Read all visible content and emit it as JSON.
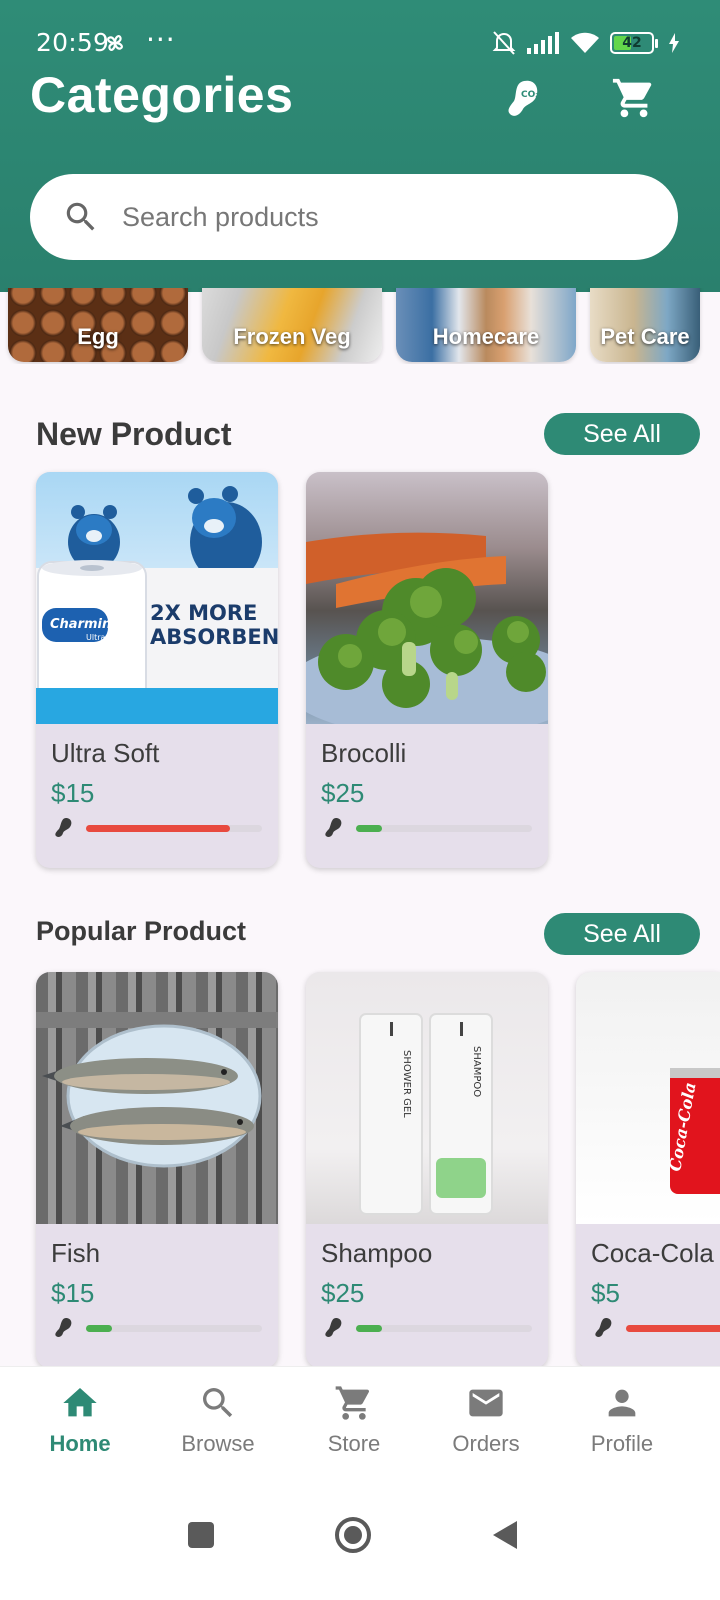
{
  "status_bar": {
    "time": "20:59",
    "dots": "···",
    "battery": "42"
  },
  "header": {
    "title": "Categories"
  },
  "search": {
    "placeholder": "Search products"
  },
  "categories": [
    {
      "label": "Egg"
    },
    {
      "label": "Frozen Veg"
    },
    {
      "label": "Homecare"
    },
    {
      "label": "Pet Care"
    }
  ],
  "new_product": {
    "title": "New Product",
    "see_all": "See All",
    "items": [
      {
        "name": "Ultra Soft",
        "price": "$15",
        "co2_level": 0.82,
        "co2_color": "#e84a3f"
      },
      {
        "name": "Brocolli",
        "price": "$25",
        "co2_level": 0.15,
        "co2_color": "#4caf50"
      }
    ]
  },
  "popular_product": {
    "title": "Popular Product",
    "see_all": "See All",
    "items": [
      {
        "name": "Fish",
        "price": "$15",
        "co2_level": 0.15,
        "co2_color": "#4caf50"
      },
      {
        "name": "Shampoo",
        "price": "$25",
        "co2_level": 0.15,
        "co2_color": "#4caf50"
      },
      {
        "name": "Coca-Cola",
        "price": "$5",
        "co2_level": 0.82,
        "co2_color": "#e84a3f"
      }
    ]
  },
  "image_text": {
    "charmin_logo": "Charmin",
    "charmin_sub": "Ultra Soft",
    "charmin_claim_1": "2X MORE",
    "charmin_claim_2": "ABSORBENT",
    "shower_gel": "SHOWER GEL",
    "shampoo": "SHAMPOO",
    "coke": "Coca-Cola"
  },
  "bottom_nav": [
    {
      "label": "Home",
      "icon": "home-icon",
      "active": true
    },
    {
      "label": "Browse",
      "icon": "search-icon",
      "active": false
    },
    {
      "label": "Store",
      "icon": "cart-icon",
      "active": false
    },
    {
      "label": "Orders",
      "icon": "mail-icon",
      "active": false
    },
    {
      "label": "Profile",
      "icon": "person-icon",
      "active": false
    }
  ],
  "colors": {
    "primary": "#2e8a75",
    "header": "#2f8c77",
    "card_bg": "#e6dfeb",
    "co2_high": "#e84a3f",
    "co2_low": "#4caf50"
  }
}
